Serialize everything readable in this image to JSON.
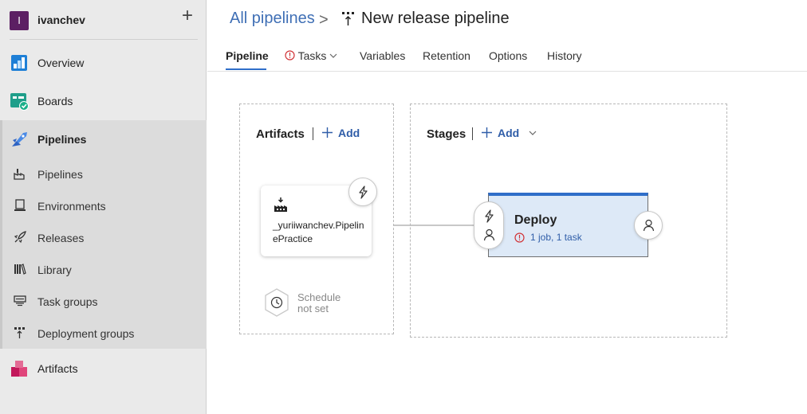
{
  "org": {
    "initial": "I",
    "name": "ivanchev",
    "add": "+"
  },
  "nav": {
    "overview": "Overview",
    "boards": "Boards",
    "pipelines": "Pipelines",
    "sub": [
      "Pipelines",
      "Environments",
      "Releases",
      "Library",
      "Task groups",
      "Deployment groups"
    ],
    "artifacts": "Artifacts"
  },
  "breadcrumb": {
    "parent": "All pipelines",
    "separator": ">",
    "title": "New release pipeline"
  },
  "tabs": {
    "pipeline": "Pipeline",
    "tasks": "Tasks",
    "variables": "Variables",
    "retention": "Retention",
    "options": "Options",
    "history": "History"
  },
  "artifacts_panel": {
    "title": "Artifacts",
    "add": "Add",
    "artifact_name": "_yuriiwanchev.PipelinePractice",
    "schedule": [
      "Schedule",
      "not set"
    ]
  },
  "stages_panel": {
    "title": "Stages",
    "add": "Add",
    "stage": {
      "name": "Deploy",
      "summary": "1 job, 1 task"
    }
  },
  "colors": {
    "accent": "#2f6ec9",
    "link": "#3f6fb5",
    "error": "#d13438",
    "stage_bg": "#dde9f7",
    "org": "#5c1f63"
  }
}
